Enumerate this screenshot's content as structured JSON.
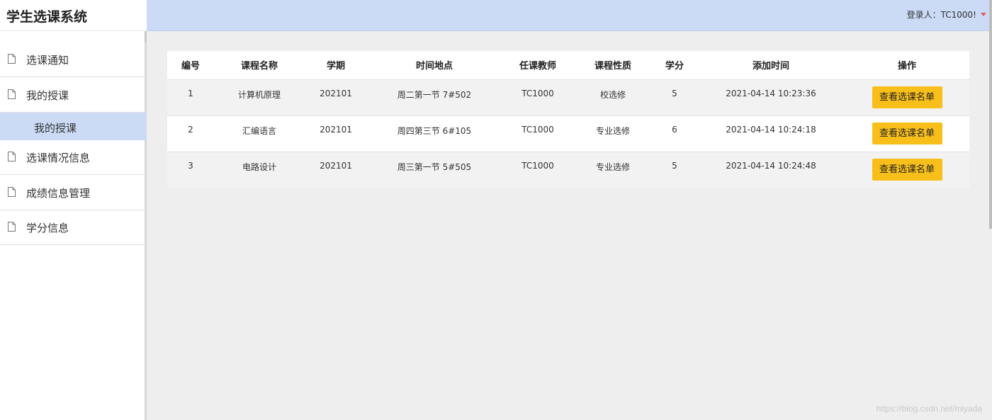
{
  "app": {
    "title": "学生选课系统"
  },
  "header": {
    "login_text": "登录人：TC1000!"
  },
  "sidebar": {
    "items": [
      {
        "label": "选课通知"
      },
      {
        "label": "我的授课"
      },
      {
        "label": "选课情况信息"
      },
      {
        "label": "成绩信息管理"
      },
      {
        "label": "学分信息"
      }
    ],
    "sub_item": {
      "label": "我的授课"
    }
  },
  "table": {
    "headers": [
      "编号",
      "课程名称",
      "学期",
      "时间地点",
      "任课教师",
      "课程性质",
      "学分",
      "添加时间",
      "操作"
    ],
    "rows": [
      {
        "id": "1",
        "name": "计算机原理",
        "term": "202101",
        "time_place": "周二第一节 7#502",
        "teacher": "TC1000",
        "type": "校选修",
        "credit": "5",
        "added": "2021-04-14 10:23:36",
        "action": "查看选课名单"
      },
      {
        "id": "2",
        "name": "汇编语言",
        "term": "202101",
        "time_place": "周四第三节 6#105",
        "teacher": "TC1000",
        "type": "专业选修",
        "credit": "6",
        "added": "2021-04-14 10:24:18",
        "action": "查看选课名单"
      },
      {
        "id": "3",
        "name": "电路设计",
        "term": "202101",
        "time_place": "周三第一节 5#505",
        "teacher": "TC1000",
        "type": "专业选修",
        "credit": "5",
        "added": "2021-04-14 10:24:48",
        "action": "查看选课名单"
      }
    ]
  },
  "watermark": "https://blog.csdn.net/miyada",
  "colors": {
    "header_bg": "#cbdaf5",
    "button_bg": "#f8bf1a",
    "page_bg": "#eeeeee"
  },
  "icons": {
    "nav_item": "document-icon",
    "user_menu": "caret-down-icon"
  }
}
